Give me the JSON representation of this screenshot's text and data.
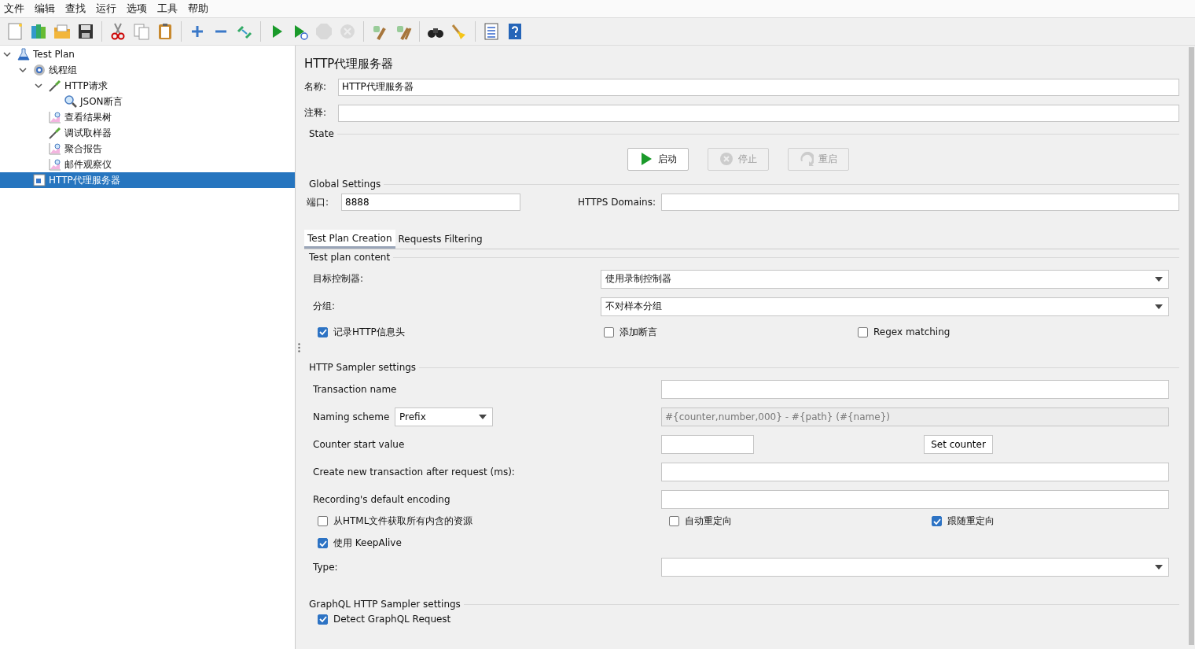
{
  "menu": [
    "文件",
    "编辑",
    "查找",
    "运行",
    "选项",
    "工具",
    "帮助"
  ],
  "toolbar": [
    {
      "kind": "new",
      "disabled": false
    },
    {
      "kind": "templates",
      "disabled": false
    },
    {
      "kind": "open",
      "disabled": false
    },
    {
      "kind": "save",
      "disabled": false
    },
    {
      "kind": "sep"
    },
    {
      "kind": "cut",
      "disabled": false
    },
    {
      "kind": "copy",
      "disabled": false
    },
    {
      "kind": "paste",
      "disabled": false
    },
    {
      "kind": "sep"
    },
    {
      "kind": "expand",
      "disabled": false
    },
    {
      "kind": "collapse",
      "disabled": false
    },
    {
      "kind": "toggle",
      "disabled": false
    },
    {
      "kind": "sep"
    },
    {
      "kind": "start",
      "disabled": false
    },
    {
      "kind": "start-no-pause",
      "disabled": false
    },
    {
      "kind": "stop",
      "disabled": true
    },
    {
      "kind": "shutdown",
      "disabled": true
    },
    {
      "kind": "sep"
    },
    {
      "kind": "clear",
      "disabled": false
    },
    {
      "kind": "clear-all",
      "disabled": false
    },
    {
      "kind": "sep"
    },
    {
      "kind": "search",
      "disabled": false
    },
    {
      "kind": "reset",
      "disabled": false
    },
    {
      "kind": "sep"
    },
    {
      "kind": "functions",
      "disabled": false
    },
    {
      "kind": "help",
      "disabled": false
    }
  ],
  "tree": [
    {
      "label": "Test Plan",
      "kind": "plan",
      "expanded": true,
      "selected": false,
      "children": [
        {
          "label": "线程组",
          "kind": "threads",
          "expanded": true,
          "selected": false,
          "children": [
            {
              "label": "HTTP请求",
              "kind": "sampler",
              "expanded": true,
              "selected": false,
              "children": [
                {
                  "label": "JSON断言",
                  "kind": "assertion",
                  "selected": false
                }
              ]
            },
            {
              "label": "查看结果树",
              "kind": "listener",
              "selected": false
            },
            {
              "label": "调试取样器",
              "kind": "sampler",
              "selected": false
            },
            {
              "label": "聚合报告",
              "kind": "listener",
              "selected": false
            },
            {
              "label": "邮件观察仪",
              "kind": "listener",
              "selected": false
            }
          ]
        },
        {
          "label": "HTTP代理服务器",
          "kind": "proxy",
          "selected": true
        }
      ]
    }
  ],
  "panel": {
    "title": "HTTP代理服务器",
    "name": {
      "label": "名称:",
      "value": "HTTP代理服务器"
    },
    "comment": {
      "label": "注释:"
    },
    "state": {
      "title": "State",
      "buttons": [
        {
          "label": "启动",
          "kind": "start",
          "disabled": false
        },
        {
          "label": "停止",
          "kind": "stop",
          "disabled": true
        },
        {
          "label": "重启",
          "kind": "restart",
          "disabled": true
        }
      ]
    },
    "global": {
      "title": "Global Settings",
      "port_label": "端口:",
      "port_value": "8888",
      "https_label": "HTTPS Domains:"
    },
    "tabs": [
      {
        "label": "Test Plan Creation",
        "selected": true
      },
      {
        "label": "Requests Filtering",
        "selected": false
      }
    ],
    "content": {
      "title": "Test plan content",
      "target_label": "目标控制器:",
      "target_value": "使用录制控制器",
      "group_label": "分组:",
      "group_value": "不对样本分组",
      "checks": [
        {
          "label": "记录HTTP信息头",
          "checked": true
        },
        {
          "label": "添加断言",
          "checked": false
        },
        {
          "label": "Regex matching",
          "checked": false
        }
      ]
    },
    "sampler": {
      "title": "HTTP Sampler settings",
      "transaction_label": "Transaction name",
      "naming_label": "Naming scheme",
      "naming_value": "Prefix",
      "naming_format": "#{counter,number,000} - #{path} (#{name})",
      "counter_label": "Counter start value",
      "counter_button": "Set counter",
      "create_label": "Create new transaction after request (ms):",
      "encoding_label": "Recording's default encoding",
      "checks": [
        {
          "label": "从HTML文件获取所有内含的资源",
          "checked": false
        },
        {
          "label": "自动重定向",
          "checked": false
        },
        {
          "label": "跟随重定向",
          "checked": true
        },
        {
          "label": "使用 KeepAlive",
          "checked": true
        }
      ],
      "type_label": "Type:"
    },
    "graphql": {
      "title": "GraphQL HTTP Sampler settings",
      "checks": [
        {
          "label": "Detect GraphQL Request",
          "checked": true
        }
      ]
    }
  }
}
